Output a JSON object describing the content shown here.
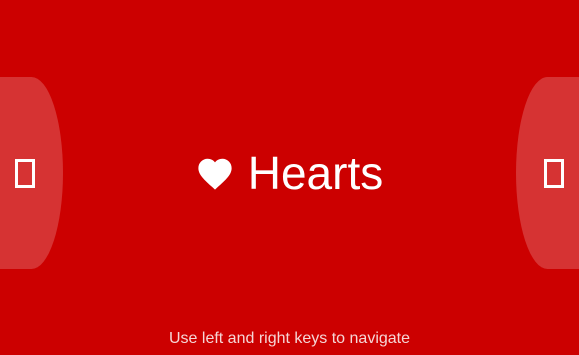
{
  "theme": {
    "background": "#cc0000",
    "nav_button_fill": "rgba(255,255,255,0.2)",
    "text": "#ffffff"
  },
  "nav": {
    "prev_icon": "missing-glyph-box",
    "next_icon": "missing-glyph-box"
  },
  "suit": {
    "icon": "heart-icon",
    "name": "Hearts"
  },
  "hint": "Use left and right keys to navigate"
}
